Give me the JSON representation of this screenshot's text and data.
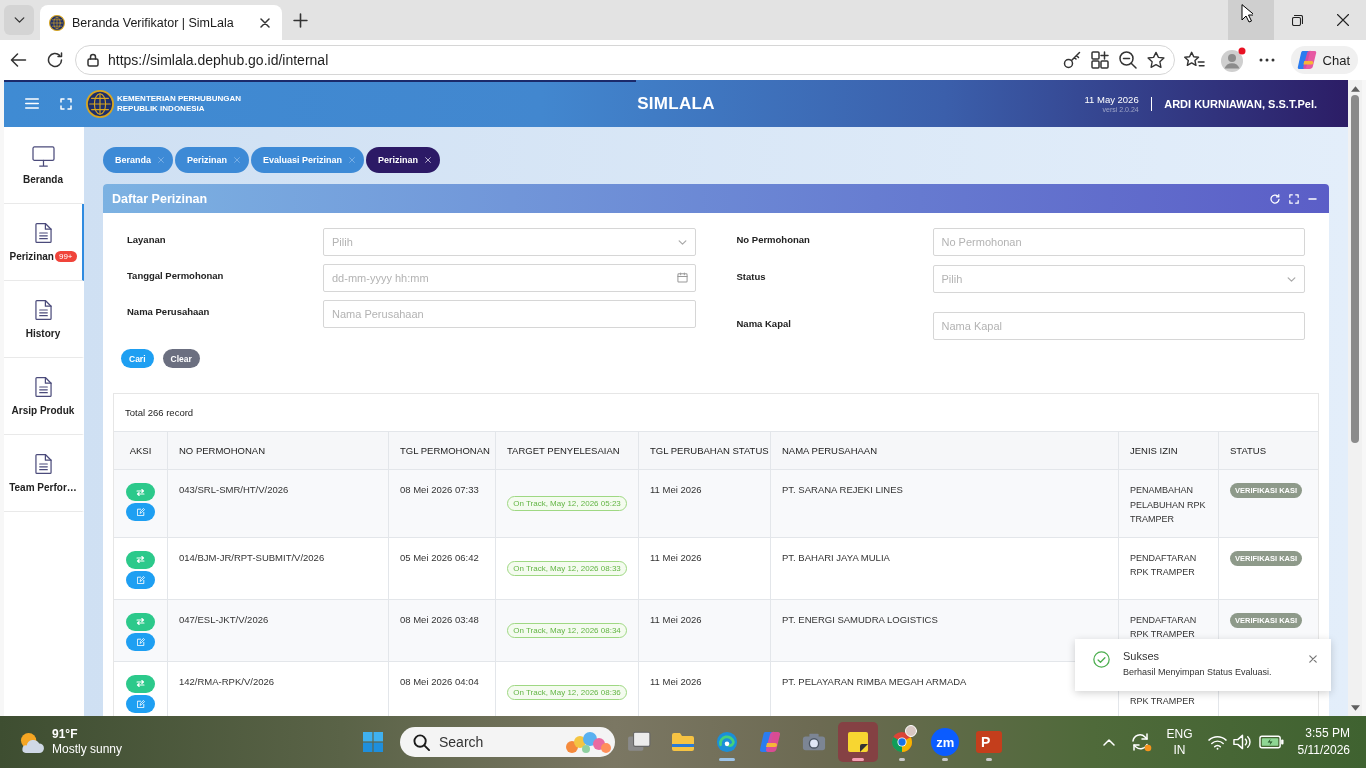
{
  "browser": {
    "tab": {
      "title": "Beranda Verifikator | SimLala",
      "selected": true
    },
    "window": {
      "minimize_hovered": true
    },
    "url": "https://simlala.dephub.go.id/internal",
    "profile": {
      "notification": true
    },
    "chat_label": "Chat"
  },
  "header": {
    "loading_bar": {
      "level": 0.47
    },
    "org_lines": [
      "KEMENTERIAN PERHUBUNGAN",
      "REPUBLIK INDONESIA"
    ],
    "app_name": "SIMLALA",
    "date": "11 May 2026",
    "version": "versi 2.0.24",
    "user": "ARDI KURNIAWAN, S.S.T.Pel."
  },
  "sidebar": {
    "items": [
      {
        "label": "Beranda",
        "kind": "monitor",
        "selected": false
      },
      {
        "label": "Perizinan",
        "kind": "document",
        "selected": true,
        "badge": "99+"
      },
      {
        "label": "History",
        "kind": "document",
        "selected": false
      },
      {
        "label": "Arsip Produk",
        "kind": "document",
        "selected": false
      },
      {
        "label": "Team Perfor…",
        "kind": "document",
        "selected": false
      }
    ]
  },
  "breadcrumbs": [
    {
      "label": "Beranda",
      "selected": false
    },
    {
      "label": "Perizinan",
      "selected": false
    },
    {
      "label": "Evaluasi Perizinan",
      "selected": false
    },
    {
      "label": "Perizinan",
      "selected": true
    }
  ],
  "panel": {
    "title": "Daftar Perizinan",
    "filters_left": [
      {
        "label": "Layanan",
        "kind": "select",
        "placeholder": "Pilih"
      },
      {
        "label": "Tanggal Permohonan",
        "kind": "date",
        "placeholder": "dd-mm-yyyy hh:mm"
      },
      {
        "label": "Nama Perusahaan",
        "kind": "text",
        "placeholder": "Nama Perusahaan"
      }
    ],
    "filters_right": [
      {
        "label": "No Permohonan",
        "kind": "text",
        "placeholder": "No Permohonan"
      },
      {
        "label": "Status",
        "kind": "select",
        "placeholder": "Pilih"
      },
      {
        "label": "Nama Kapal",
        "kind": "text",
        "placeholder": "Nama Kapal"
      }
    ],
    "buttons": [
      {
        "label": "Cari",
        "kind": "primary"
      },
      {
        "label": "Clear",
        "kind": "secondary"
      }
    ],
    "table": {
      "total": "Total 266 record",
      "columns": [
        "AKSI",
        "NO PERMOHONAN",
        "TGL PERMOHONAN",
        "TARGET PENYELESAIAN",
        "TGL PERUBAHAN STATUS",
        "NAMA PERUSAHAAN",
        "JENIS IZIN",
        "STATUS"
      ],
      "rows": [
        {
          "no": "043/SRL-SMR/HT/V/2026",
          "tgl_permohonan": "08 Mei 2026 07:33",
          "target": "On Track, May 12, 2026 05:23",
          "tgl_perubahan_status": "11 Mei 2026",
          "nama_perusahaan": "PT. SARANA REJEKI LINES",
          "jenis_izin": "PENAMBAHAN PELABUHAN RPK TRAMPER",
          "status": "VERIFIKASI KASI"
        },
        {
          "no": "014/BJM-JR/RPT-SUBMIT/V/2026",
          "tgl_permohonan": "05 Mei 2026 06:42",
          "target": "On Track, May 12, 2026 08:33",
          "tgl_perubahan_status": "11 Mei 2026",
          "nama_perusahaan": "PT. BAHARI JAYA MULIA",
          "jenis_izin": "PENDAFTARAN RPK TRAMPER",
          "status": "VERIFIKASI KASI"
        },
        {
          "no": "047/ESL-JKT/V/2026",
          "tgl_permohonan": "08 Mei 2026 03:48",
          "target": "On Track, May 12, 2026 08:34",
          "tgl_perubahan_status": "11 Mei 2026",
          "nama_perusahaan": "PT. ENERGI SAMUDRA LOGISTICS",
          "jenis_izin": "PENDAFTARAN RPK TRAMPER",
          "status": "VERIFIKASI KASI"
        },
        {
          "no": "142/RMA-RPK/V/2026",
          "tgl_permohonan": "08 Mei 2026 04:04",
          "target": "On Track, May 12, 2026 08:36",
          "tgl_perubahan_status": "11 Mei 2026",
          "nama_perusahaan": "PT. PELAYARAN RIMBA MEGAH ARMADA",
          "jenis_izin": "RPK TRAMPER"
        }
      ]
    }
  },
  "toast": {
    "kind": "success",
    "title": "Sukses",
    "message": "Berhasil Menyimpan Status Evaluasi."
  },
  "taskbar": {
    "weather": {
      "temp": "91°F",
      "condition": "Mostly sunny"
    },
    "search_label": "Search",
    "apps": [
      {
        "kind": "task_view",
        "running": false,
        "selected": false,
        "flashing": false
      },
      {
        "kind": "file_explorer",
        "running": false,
        "selected": false,
        "flashing": false
      },
      {
        "kind": "edge",
        "running": true,
        "selected": true,
        "flashing": false
      },
      {
        "kind": "copilot",
        "running": false,
        "selected": false,
        "flashing": false
      },
      {
        "kind": "camera",
        "running": false,
        "selected": false,
        "flashing": false
      },
      {
        "kind": "sticky_notes",
        "running": true,
        "selected": false,
        "flashing": true
      },
      {
        "kind": "chrome",
        "running": true,
        "selected": false,
        "flashing": false
      },
      {
        "kind": "zoom",
        "running": true,
        "selected": false,
        "flashing": false,
        "glyph": "zm"
      },
      {
        "kind": "powerpoint",
        "running": true,
        "selected": false,
        "flashing": false,
        "glyph": "P"
      }
    ],
    "language": [
      "ENG",
      "IN"
    ],
    "time": "3:55 PM",
    "date": "5/11/2026"
  }
}
